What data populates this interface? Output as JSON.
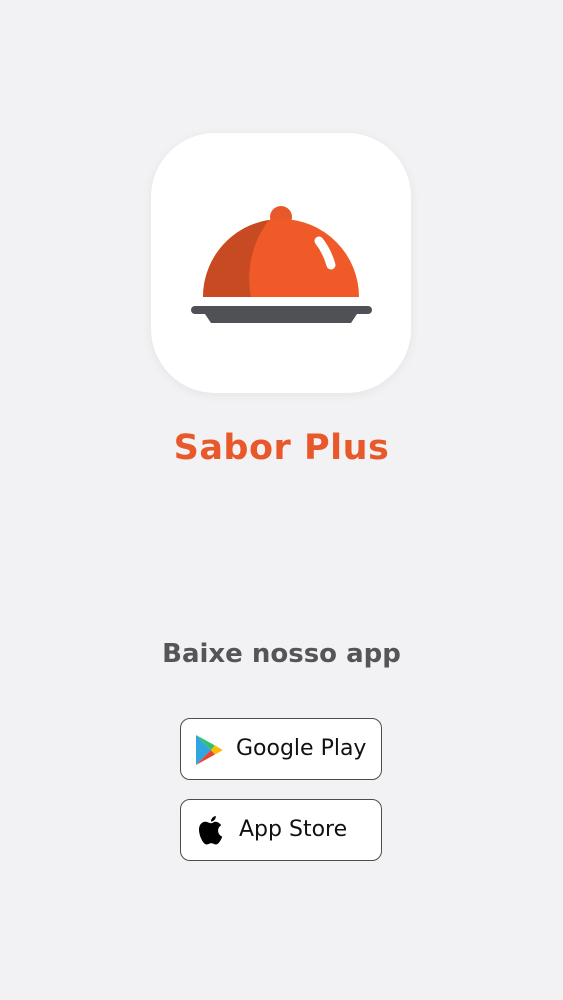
{
  "app": {
    "name": "Sabor Plus",
    "icon": "cloche-icon",
    "brand_color": "#e9582a"
  },
  "download": {
    "label": "Baixe nosso app"
  },
  "stores": {
    "google_play": {
      "label": "Google Play",
      "icon": "google-play-icon"
    },
    "app_store": {
      "label": "App Store",
      "icon": "apple-icon"
    }
  },
  "colors": {
    "background": "#f2f1f3",
    "accent": "#e9582a",
    "text_dark": "#555458"
  }
}
